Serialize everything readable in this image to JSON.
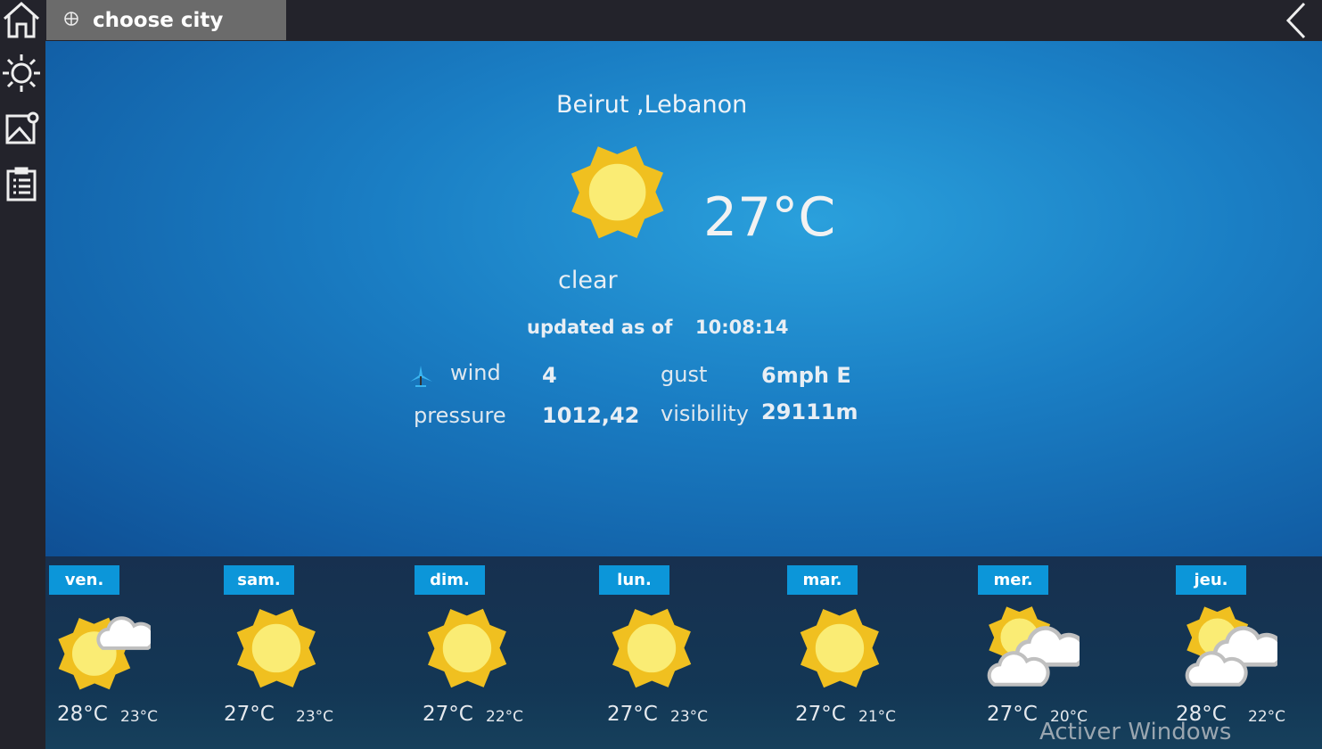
{
  "sidebar": {
    "items": [
      {
        "icon": "home-icon"
      },
      {
        "icon": "sun-icon"
      },
      {
        "icon": "map-icon"
      },
      {
        "icon": "list-icon"
      }
    ]
  },
  "topbar": {
    "choose_city": "choose city",
    "icon": "globe-pin-icon",
    "back_icon": "chevron-left-icon"
  },
  "current": {
    "location": "Beirut ,Lebanon",
    "icon": "sun",
    "temperature": "27°C",
    "condition": "clear",
    "updated_label": "updated as of",
    "updated_time": "10:08:14",
    "wind_label": "wind",
    "wind_value": "4",
    "gust_label": "gust",
    "gust_value": "6mph E",
    "pressure_label": "pressure",
    "pressure_value": "1012,42",
    "visibility_label": "visibility",
    "visibility_value": "29111m"
  },
  "forecast": [
    {
      "day": "ven.",
      "icon": "sun-small-cloud",
      "high": "28°C",
      "low": "23°C"
    },
    {
      "day": "sam.",
      "icon": "sun",
      "high": "27°C",
      "low": "23°C"
    },
    {
      "day": "dim.",
      "icon": "sun",
      "high": "27°C",
      "low": "22°C"
    },
    {
      "day": "lun.",
      "icon": "sun",
      "high": "27°C",
      "low": "23°C"
    },
    {
      "day": "mar.",
      "icon": "sun",
      "high": "27°C",
      "low": "21°C"
    },
    {
      "day": "mer.",
      "icon": "sun-clouds",
      "high": "27°C",
      "low": "20°C"
    },
    {
      "day": "jeu.",
      "icon": "sun-clouds",
      "high": "28°C",
      "low": "22°C"
    }
  ],
  "watermark": "Activer Windows",
  "colors": {
    "accent": "#0c96d9",
    "sun": "#f0c020",
    "sun_core": "#faec74"
  }
}
